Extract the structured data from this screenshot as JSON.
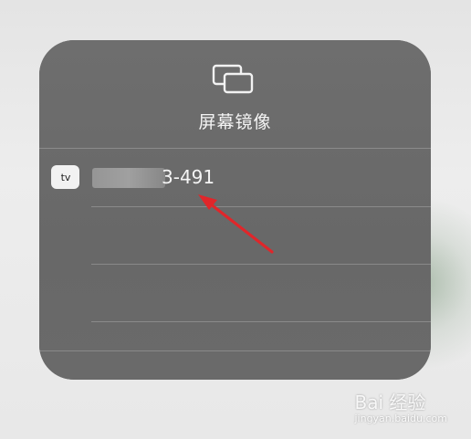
{
  "panel": {
    "icon": "screen-mirroring-icon",
    "title": "屏幕镜像"
  },
  "devices": [
    {
      "icon": "apple-tv-icon",
      "icon_label": "tv",
      "name_visible": "3-491"
    }
  ],
  "annotation": {
    "arrow_color": "#e0262a"
  },
  "watermark": {
    "text": "Bai 经验",
    "sub": "jingyan.baidu.com"
  }
}
